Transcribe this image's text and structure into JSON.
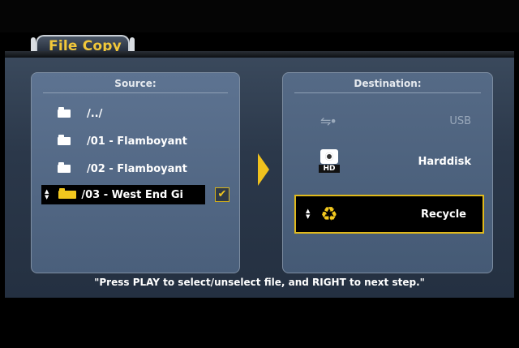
{
  "window": {
    "title": "File Copy"
  },
  "source": {
    "title": "Source:",
    "items": [
      {
        "label": "/../"
      },
      {
        "label": "/01 - Flamboyant"
      },
      {
        "label": "/02 - Flamboyant"
      },
      {
        "label": "/03 - West End Gi",
        "checked": true
      }
    ],
    "check_mark": "✔"
  },
  "destination": {
    "title": "Destination:",
    "items": [
      {
        "label": "USB",
        "icon": "usb-icon",
        "enabled": false
      },
      {
        "label": "Harddisk",
        "icon": "harddisk-icon",
        "icon_text": "HD"
      },
      {
        "label": "Recycle",
        "icon": "recycle-icon",
        "selected": true
      }
    ]
  },
  "footer": {
    "hint": "\"Press PLAY to select/unselect file, and RIGHT to next step.\""
  },
  "colors": {
    "accent": "#f2c81e",
    "panel": "#5d7391",
    "background": "#2b384a"
  },
  "glyphs": {
    "up": "▲",
    "down": "▼",
    "usb": "⇋•",
    "recycle": "♻"
  }
}
